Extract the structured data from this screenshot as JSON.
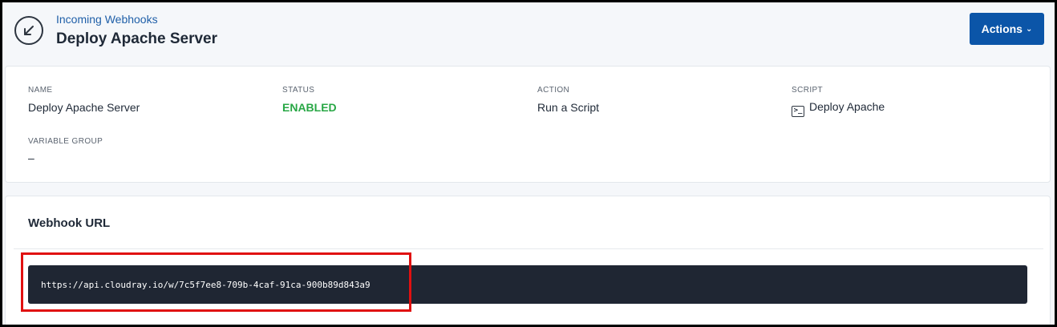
{
  "header": {
    "breadcrumb": "Incoming Webhooks",
    "title": "Deploy Apache Server",
    "actions_label": "Actions",
    "back_icon": "arrow-down-left-icon"
  },
  "details": {
    "name_label": "NAME",
    "name_value": "Deploy Apache Server",
    "status_label": "STATUS",
    "status_value": "ENABLED",
    "action_label": "ACTION",
    "action_value": "Run a Script",
    "script_label": "SCRIPT",
    "script_value": "Deploy Apache",
    "variable_group_label": "VARIABLE GROUP",
    "variable_group_value": "–"
  },
  "webhook": {
    "title": "Webhook URL",
    "url": "https://api.cloudray.io/w/7c5f7ee8-709b-4caf-91ca-900b89d843a9"
  },
  "colors": {
    "accent": "#0b55a8",
    "status_enabled": "#28a745",
    "url_background": "#1f2633",
    "highlight": "#e01010"
  }
}
